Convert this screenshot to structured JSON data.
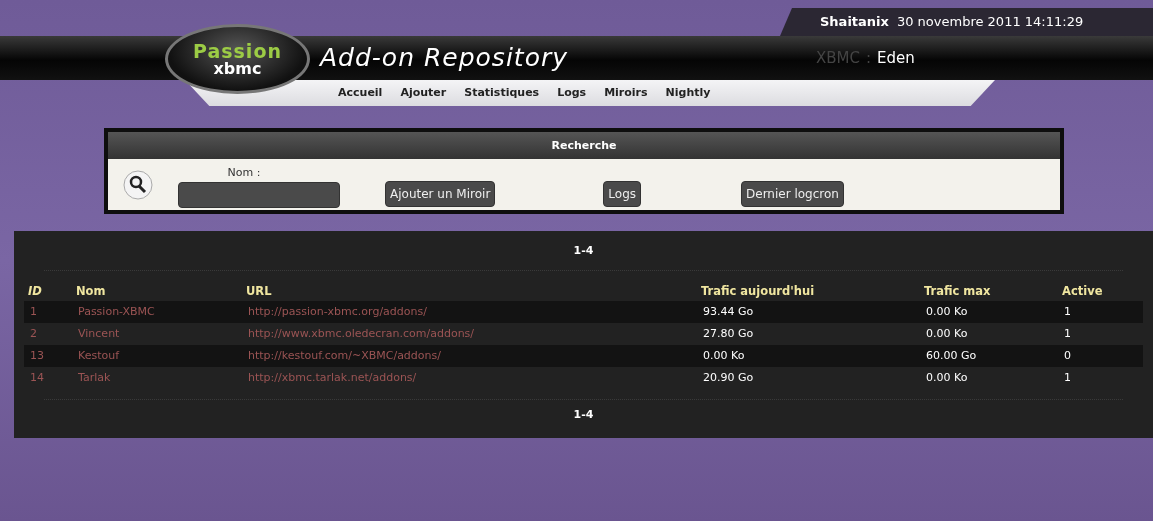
{
  "user_bar": {
    "user": "Shaitanix",
    "datetime": "30 novembre 2011 14:11:29"
  },
  "header": {
    "logo_top": "Passion",
    "logo_bottom": "xbmc",
    "title": "Add-on Repository",
    "version_label": "XBMC",
    "version_separator": ":",
    "version": "Eden"
  },
  "nav": [
    "Accueil",
    "Ajouter",
    "Statistiques",
    "Logs",
    "Miroirs",
    "Nightly"
  ],
  "search": {
    "title": "Recherche",
    "field_label": "Nom :",
    "buttons": [
      "Ajouter un Miroir",
      "Logs",
      "Dernier logcron"
    ]
  },
  "table": {
    "pagination_top": "1-4",
    "pagination_bottom": "1-4",
    "columns": [
      "ID",
      "Nom",
      "URL",
      "Trafic aujourd'hui",
      "Trafic max",
      "Active"
    ],
    "rows": [
      {
        "cells": [
          "1",
          "Passion-XBMC",
          "http://passion-xbmc.org/addons/",
          "93.44 Go",
          "0.00 Ko",
          "1"
        ]
      },
      {
        "cells": [
          "2",
          "Vincent",
          "http://www.xbmc.oledecran.com/addons/",
          "27.80 Go",
          "0.00 Ko",
          "1"
        ]
      },
      {
        "cells": [
          "13",
          "Kestouf",
          "http://kestouf.com/~XBMC/addons/",
          "0.00 Ko",
          "60.00 Go",
          "0"
        ]
      },
      {
        "cells": [
          "14",
          "Tarlak",
          "http://xbmc.tarlak.net/addons/",
          "20.90 Go",
          "0.00 Ko",
          "1"
        ]
      }
    ]
  }
}
